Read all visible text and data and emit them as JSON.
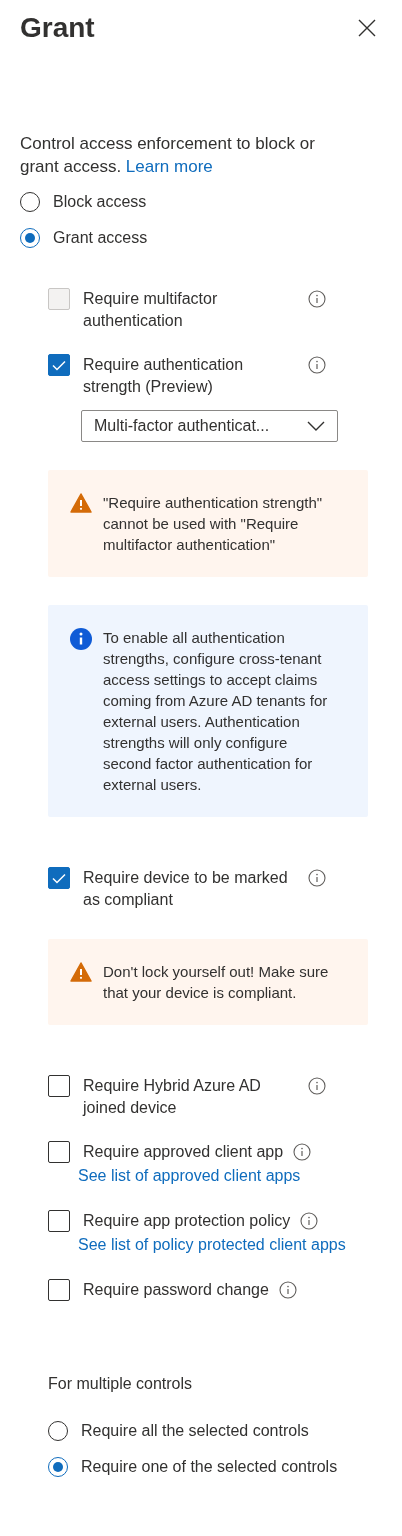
{
  "title": "Grant",
  "description": "Control access enforcement to block or grant access.",
  "description_link": "Learn more",
  "access_options": [
    {
      "label": "Block access",
      "selected": false
    },
    {
      "label": "Grant access",
      "selected": true
    }
  ],
  "controls": [
    {
      "kind": "checkbox",
      "label": "Require multifactor authentication",
      "checked": false,
      "disabled": true
    },
    {
      "kind": "checkbox",
      "label": "Require authentication strength (Preview)",
      "checked": true,
      "disabled": false,
      "dropdown": "Multi-factor authenticat..."
    },
    {
      "kind": "warning",
      "text": "\"Require authentication strength\" cannot be used with \"Require multifactor authentication\""
    },
    {
      "kind": "info",
      "text": "To enable all authentication strengths, configure cross-tenant access settings to accept claims coming from Azure AD tenants for external users. Authentication strengths will only configure second factor authentication for external users."
    },
    {
      "kind": "checkbox",
      "label": "Require device to be marked as compliant",
      "checked": true,
      "disabled": false
    },
    {
      "kind": "warning",
      "text": "Don't lock yourself out! Make sure that your device is compliant."
    },
    {
      "kind": "checkbox",
      "label": "Require Hybrid Azure AD joined device",
      "checked": false,
      "disabled": false
    },
    {
      "kind": "checkbox",
      "label": "Require approved client app",
      "checked": false,
      "disabled": false,
      "link": "See list of approved client apps"
    },
    {
      "kind": "checkbox",
      "label": "Require app protection policy",
      "checked": false,
      "disabled": false,
      "link": "See list of policy protected client apps"
    },
    {
      "kind": "checkbox",
      "label": "Require password change",
      "checked": false,
      "disabled": false
    }
  ],
  "multiple_heading": "For multiple controls",
  "multiple_options": [
    {
      "label": "Require all the selected controls",
      "selected": false
    },
    {
      "label": "Require one of the selected controls",
      "selected": true
    }
  ]
}
